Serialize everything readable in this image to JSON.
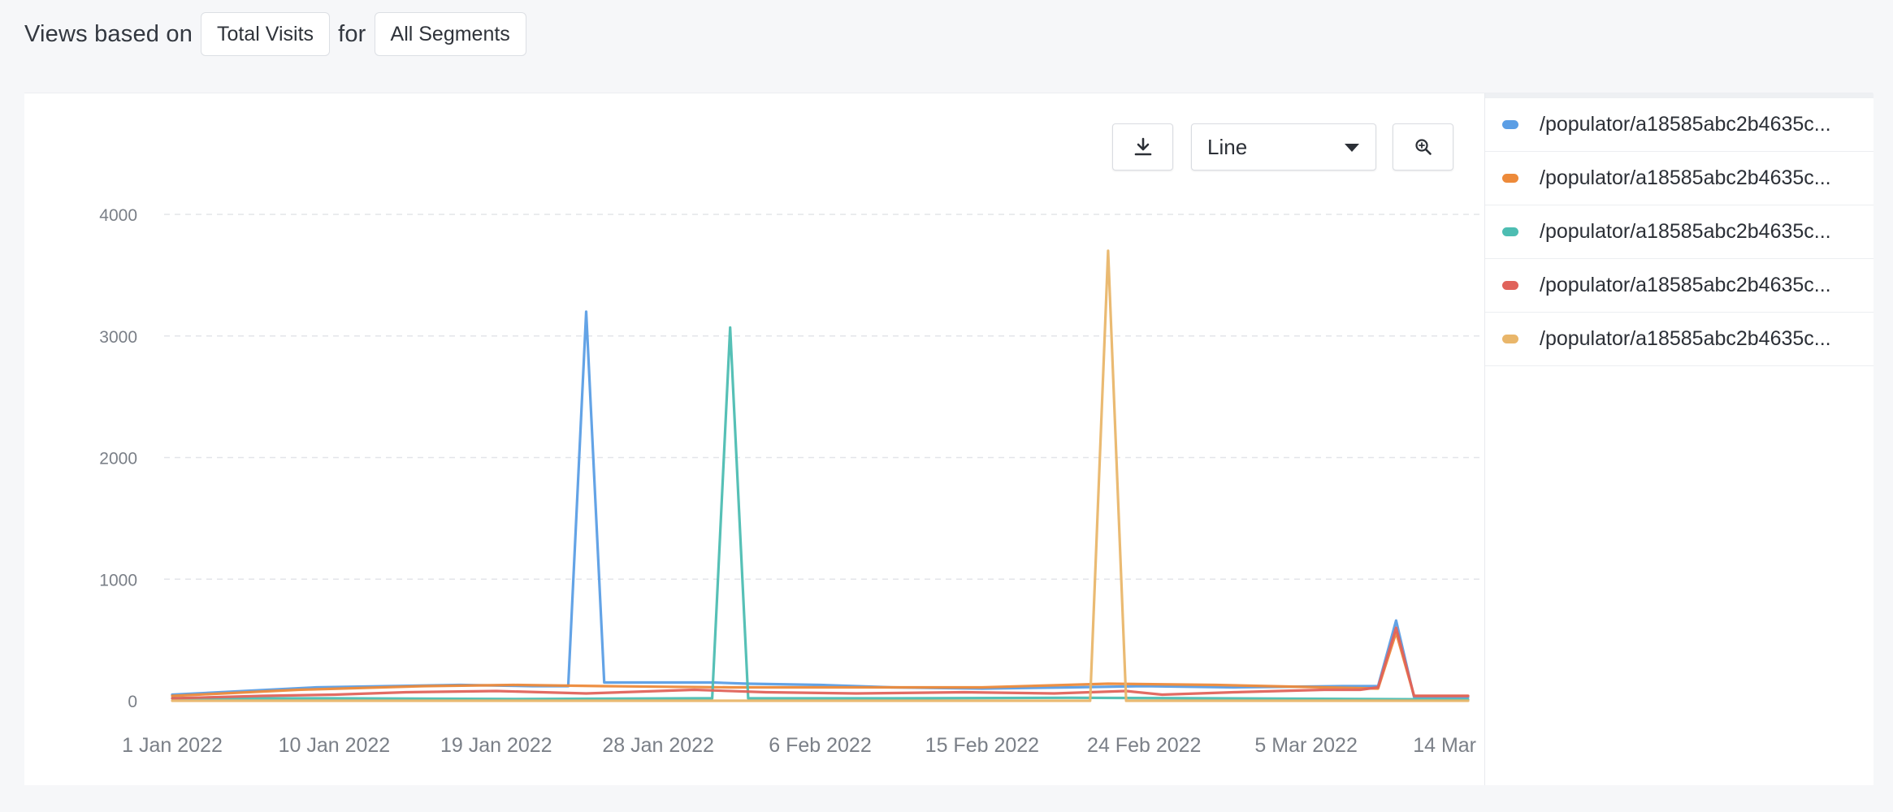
{
  "header": {
    "prefix": "Views based on",
    "metric": "Total Visits",
    "joiner": "for",
    "segment": "All Segments"
  },
  "toolbar": {
    "download_icon": "download-icon",
    "chart_type": "Line",
    "zoom_icon": "zoom-in-icon"
  },
  "legend": [
    {
      "label": "/populator/a18585abc2b4635c...",
      "color": "#5b9ee5"
    },
    {
      "label": "/populator/a18585abc2b4635c...",
      "color": "#ed8a3a"
    },
    {
      "label": "/populator/a18585abc2b4635c...",
      "color": "#4dbdb2"
    },
    {
      "label": "/populator/a18585abc2b4635c...",
      "color": "#e0635b"
    },
    {
      "label": "/populator/a18585abc2b4635c...",
      "color": "#e9b66a"
    }
  ],
  "chart_data": {
    "type": "line",
    "title": "",
    "xlabel": "",
    "ylabel": "",
    "x_start": "2022-01-01",
    "x_end": "2022-03-14",
    "ylim": [
      0,
      4000
    ],
    "y_ticks": [
      0,
      1000,
      2000,
      3000,
      4000
    ],
    "x_tick_dates": [
      "2022-01-01",
      "2022-01-10",
      "2022-01-19",
      "2022-01-28",
      "2022-02-06",
      "2022-02-15",
      "2022-02-24",
      "2022-03-05",
      "2022-03-14"
    ],
    "x_tick_labels": [
      "1 Jan 2022",
      "10 Jan 2022",
      "19 Jan 2022",
      "28 Jan 2022",
      "6 Feb 2022",
      "15 Feb 2022",
      "24 Feb 2022",
      "5 Mar 2022",
      "14 Mar"
    ],
    "grid": true,
    "series": [
      {
        "color": "#5b9ee5",
        "points": [
          [
            "2022-01-01",
            50
          ],
          [
            "2022-01-05",
            80
          ],
          [
            "2022-01-09",
            110
          ],
          [
            "2022-01-13",
            120
          ],
          [
            "2022-01-17",
            130
          ],
          [
            "2022-01-21",
            120
          ],
          [
            "2022-01-23",
            120
          ],
          [
            "2022-01-24",
            3200
          ],
          [
            "2022-01-25",
            150
          ],
          [
            "2022-01-31",
            150
          ],
          [
            "2022-02-02",
            140
          ],
          [
            "2022-02-06",
            130
          ],
          [
            "2022-02-10",
            110
          ],
          [
            "2022-02-15",
            100
          ],
          [
            "2022-02-20",
            110
          ],
          [
            "2022-02-24",
            120
          ],
          [
            "2022-03-01",
            110
          ],
          [
            "2022-03-07",
            120
          ],
          [
            "2022-03-09",
            120
          ],
          [
            "2022-03-10",
            660
          ],
          [
            "2022-03-11",
            30
          ],
          [
            "2022-03-14",
            30
          ]
        ]
      },
      {
        "color": "#ed8a3a",
        "points": [
          [
            "2022-01-01",
            40
          ],
          [
            "2022-01-08",
            90
          ],
          [
            "2022-01-15",
            120
          ],
          [
            "2022-01-20",
            130
          ],
          [
            "2022-01-25",
            120
          ],
          [
            "2022-02-01",
            110
          ],
          [
            "2022-02-08",
            110
          ],
          [
            "2022-02-15",
            110
          ],
          [
            "2022-02-22",
            140
          ],
          [
            "2022-02-28",
            130
          ],
          [
            "2022-03-06",
            110
          ],
          [
            "2022-03-09",
            100
          ],
          [
            "2022-03-10",
            560
          ],
          [
            "2022-03-11",
            40
          ],
          [
            "2022-03-14",
            40
          ]
        ]
      },
      {
        "color": "#4dbdb2",
        "points": [
          [
            "2022-01-01",
            20
          ],
          [
            "2022-01-10",
            20
          ],
          [
            "2022-01-20",
            15
          ],
          [
            "2022-01-30",
            20
          ],
          [
            "2022-01-31",
            20
          ],
          [
            "2022-02-01",
            3070
          ],
          [
            "2022-02-02",
            20
          ],
          [
            "2022-02-10",
            20
          ],
          [
            "2022-02-20",
            25
          ],
          [
            "2022-02-28",
            20
          ],
          [
            "2022-03-08",
            15
          ],
          [
            "2022-03-14",
            10
          ]
        ]
      },
      {
        "color": "#e0635b",
        "points": [
          [
            "2022-01-01",
            20
          ],
          [
            "2022-01-06",
            40
          ],
          [
            "2022-01-10",
            50
          ],
          [
            "2022-01-14",
            70
          ],
          [
            "2022-01-19",
            80
          ],
          [
            "2022-01-24",
            60
          ],
          [
            "2022-01-30",
            90
          ],
          [
            "2022-02-03",
            70
          ],
          [
            "2022-02-08",
            60
          ],
          [
            "2022-02-14",
            70
          ],
          [
            "2022-02-19",
            60
          ],
          [
            "2022-02-23",
            80
          ],
          [
            "2022-02-25",
            50
          ],
          [
            "2022-03-01",
            70
          ],
          [
            "2022-03-06",
            90
          ],
          [
            "2022-03-08",
            90
          ],
          [
            "2022-03-09",
            110
          ],
          [
            "2022-03-10",
            600
          ],
          [
            "2022-03-11",
            40
          ],
          [
            "2022-03-14",
            40
          ]
        ]
      },
      {
        "color": "#e9b66a",
        "points": [
          [
            "2022-01-01",
            0
          ],
          [
            "2022-01-10",
            0
          ],
          [
            "2022-01-20",
            0
          ],
          [
            "2022-01-30",
            0
          ],
          [
            "2022-02-08",
            0
          ],
          [
            "2022-02-14",
            0
          ],
          [
            "2022-02-21",
            0
          ],
          [
            "2022-02-22",
            3700
          ],
          [
            "2022-02-23",
            0
          ],
          [
            "2022-03-01",
            0
          ],
          [
            "2022-03-08",
            0
          ],
          [
            "2022-03-14",
            0
          ]
        ]
      }
    ]
  }
}
